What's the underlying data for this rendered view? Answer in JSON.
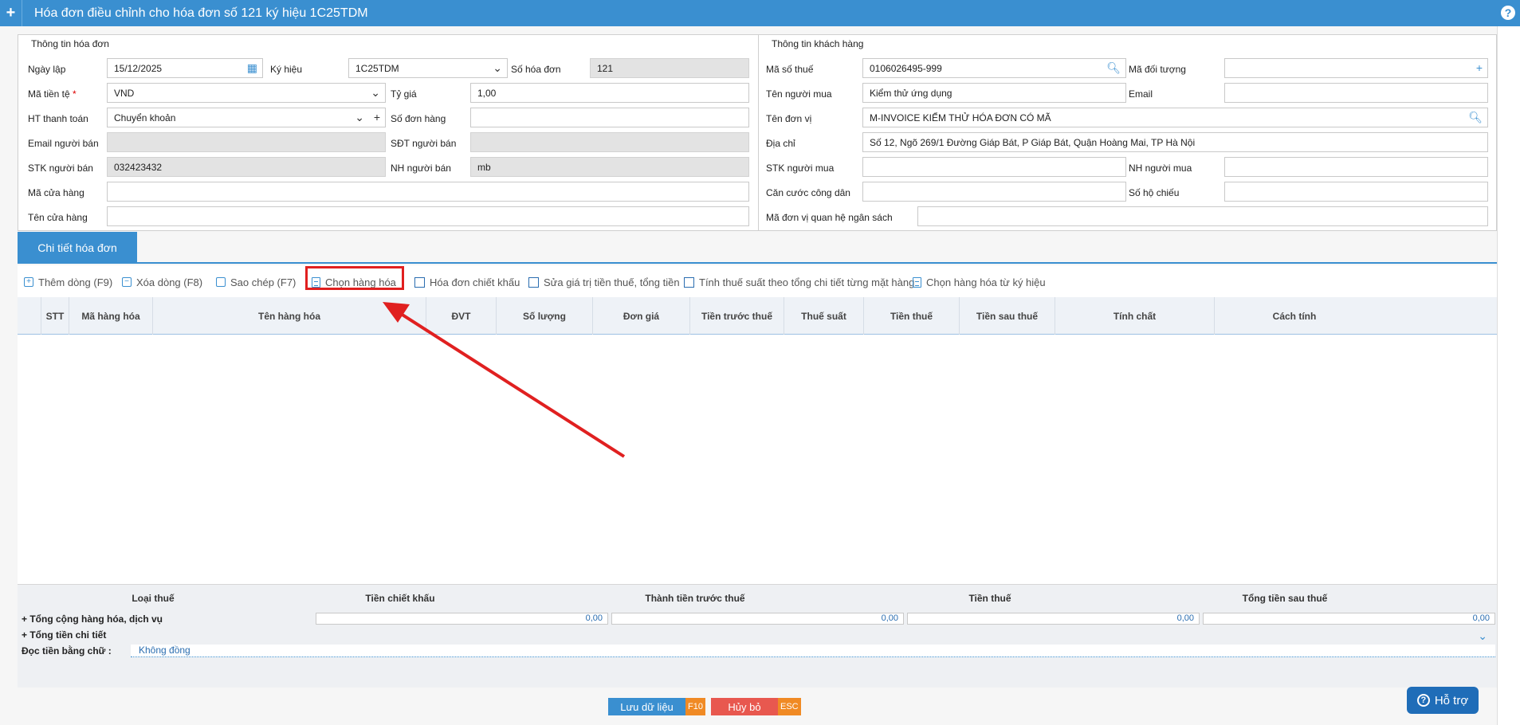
{
  "window": {
    "title": "Hóa đơn điều chỉnh cho hóa đơn số 121 ký hiệu 1C25TDM",
    "plus": "+",
    "help": "?"
  },
  "invoice_info": {
    "legend": "Thông tin hóa đơn",
    "ngay_lap_label": "Ngày lập",
    "ngay_lap": "15/12/2025",
    "ky_hieu_label": "Ký hiệu",
    "ky_hieu": "1C25TDM",
    "so_hoa_don_label": "Số hóa đơn",
    "so_hoa_don": "121",
    "ma_tien_te_label": "Mã tiền tệ",
    "required_mark": "*",
    "ma_tien_te": "VND",
    "ty_gia_label": "Tỷ giá",
    "ty_gia": "1,00",
    "ht_thanh_toan_label": "HT thanh toán",
    "ht_thanh_toan": "Chuyển khoản",
    "so_don_hang_label": "Số đơn hàng",
    "so_don_hang": "",
    "email_nguoi_ban_label": "Email người bán",
    "email_nguoi_ban": "",
    "sdt_nguoi_ban_label": "SĐT người bán",
    "sdt_nguoi_ban": "",
    "stk_nguoi_ban_label": "STK người bán",
    "stk_nguoi_ban": "032423432",
    "nh_nguoi_ban_label": "NH người bán",
    "nh_nguoi_ban": "mb",
    "ma_cua_hang_label": "Mã cửa hàng",
    "ma_cua_hang": "",
    "ten_cua_hang_label": "Tên cửa hàng",
    "ten_cua_hang": ""
  },
  "customer_info": {
    "legend": "Thông tin khách hàng",
    "ma_so_thue_label": "Mã số thuế",
    "ma_so_thue": "0106026495-999",
    "ma_doi_tuong_label": "Mã đối tượng",
    "ma_doi_tuong": "",
    "ten_nguoi_mua_label": "Tên người mua",
    "ten_nguoi_mua": "Kiểm thử ứng dụng",
    "email_label": "Email",
    "email": "",
    "ten_don_vi_label": "Tên đơn vị",
    "ten_don_vi": "M-INVOICE KIỂM THỬ HÓA ĐƠN CÓ MÃ",
    "dia_chi_label": "Địa chỉ",
    "dia_chi": "Số 12, Ngõ 269/1 Đường Giáp Bát, P Giáp Bát, Quận Hoàng Mai, TP Hà Nội",
    "stk_nguoi_mua_label": "STK người mua",
    "stk_nguoi_mua": "",
    "nh_nguoi_mua_label": "NH người mua",
    "nh_nguoi_mua": "",
    "cccd_label": "Căn cước công dân",
    "cccd": "",
    "so_ho_chieu_label": "Số hộ chiếu",
    "so_ho_chieu": "",
    "ma_dvqhns_label": "Mã đơn vị quan hệ ngân sách",
    "ma_dvqhns": ""
  },
  "tabs": [
    {
      "label": "Chi tiết hóa đơn"
    }
  ],
  "toolbar": {
    "add_row": "Thêm dòng (F9)",
    "delete_row": "Xóa dòng (F8)",
    "copy": "Sao chép (F7)",
    "choose_goods": "Chọn hàng hóa",
    "discount_invoice": "Hóa đơn chiết khấu",
    "edit_tax_total": "Sửa giá trị tiền thuế, tổng tiền",
    "tax_by_item": "Tính thuế suất theo tổng chi tiết từng mặt hàng",
    "choose_goods_from_series": "Chọn hàng hóa từ ký hiệu"
  },
  "grid": {
    "columns": [
      "STT",
      "Mã hàng hóa",
      "Tên hàng hóa",
      "ĐVT",
      "Số lượng",
      "Đơn giá",
      "Tiền trước thuế",
      "Thuế suất",
      "Tiền thuế",
      "Tiền sau thuế",
      "Tính chất",
      "Cách tính"
    ]
  },
  "summary": {
    "headers": [
      "Loại thuế",
      "Tiền chiết khấu",
      "Thành tiền trước thuế",
      "Tiền thuế",
      "Tổng tiền sau thuế"
    ],
    "row_total_label": "+ Tổng cộng hàng hóa, dịch vụ",
    "values": [
      "0,00",
      "0,00",
      "0,00",
      "0,00"
    ],
    "row_detail_label": "+ Tổng tiền chi tiết",
    "words_label": "Đọc tiền bằng chữ :",
    "words_value": "Không đồng"
  },
  "footer": {
    "save_label": "Lưu dữ liệu",
    "save_key": "F10",
    "cancel_label": "Hủy bỏ",
    "cancel_key": "ESC",
    "help_label": "Hỗ trợ"
  },
  "colors": {
    "primary": "#3a8fd0",
    "annotation": "#e02020",
    "save": "#3a8fd0",
    "cancel": "#e8584f",
    "key": "#f08a24"
  }
}
